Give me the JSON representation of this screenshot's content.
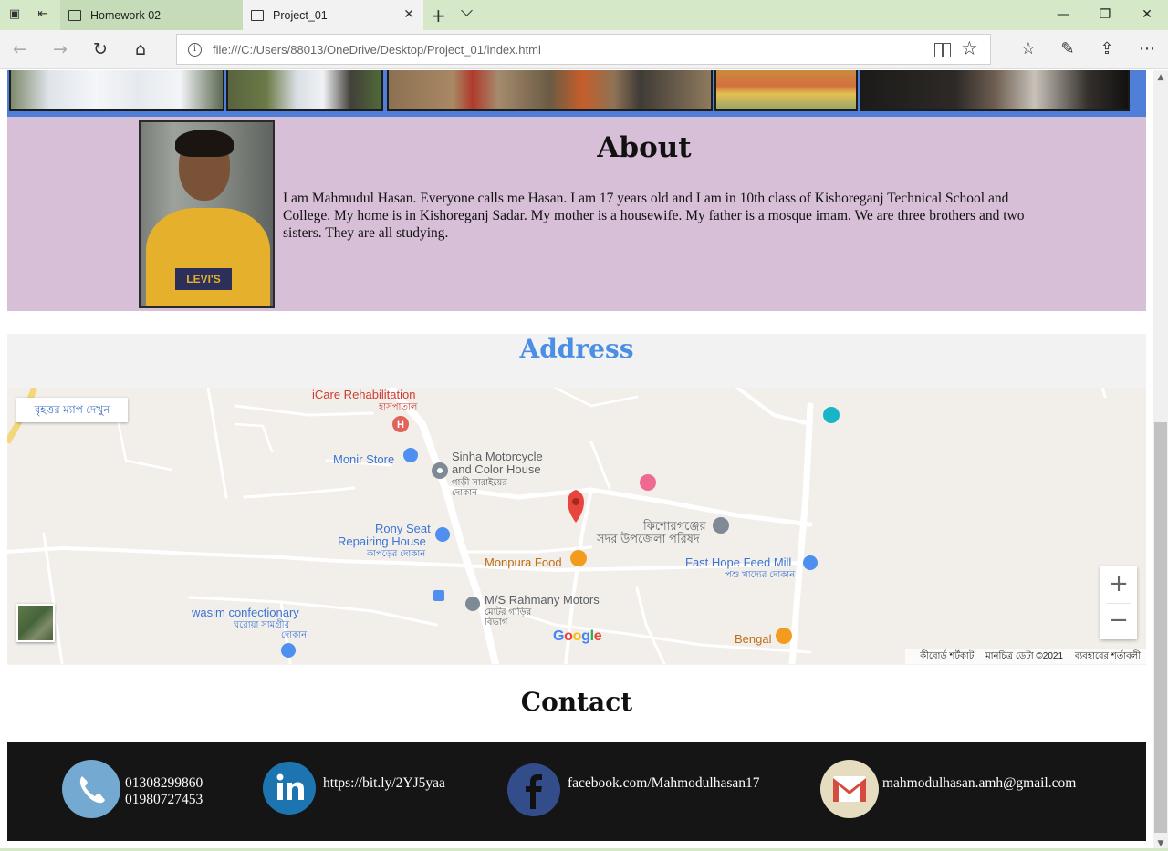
{
  "browser": {
    "tabs": [
      {
        "title": "Homework 02",
        "active": false
      },
      {
        "title": "Project_01",
        "active": true
      }
    ],
    "url": "file:///C:/Users/88013/OneDrive/Desktop/Project_01/index.html",
    "icons": {
      "tab_manager": "tabs-icon",
      "set_aside": "set-aside-icon",
      "back": "back-arrow-icon",
      "forward": "forward-arrow-icon",
      "refresh": "refresh-icon",
      "home": "home-icon",
      "favorites": "favorites-icon",
      "notes": "pen-icon",
      "share": "share-icon",
      "more": "more-icon"
    }
  },
  "about": {
    "title": "About",
    "text": "I am Mahmudul Hasan. Everyone calls me Hasan. I am 17 years old and I am in 10th class of Kishoreganj Technical School and College. My home is in Kishoreganj Sadar. My mother is a housewife. My father is a mosque imam. We are three brothers and two sisters. They are all studying.",
    "photo_shirt_text": "LEVI'S"
  },
  "address": {
    "title": "Address",
    "map": {
      "larger_map": "বৃহত্তর ম্যাপ দেখুন",
      "places": {
        "icare": "iCare Rehabilitation",
        "icare_sub": "হাসপাতাল",
        "monir": "Monir Store",
        "sinha_1": "Sinha Motorcycle",
        "sinha_2": "and Color House",
        "sinha_sub_1": "গাড়ী সারাইয়ের",
        "sinha_sub_2": "দোকান",
        "rony_1": "Rony Seat",
        "rony_2": "Repairing House",
        "rony_sub": "কাপড়ের দোকান",
        "kishoreganj_1": "কিশোরগঞ্জের",
        "kishoreganj_2": "সদর উপজেলা পরিষদ",
        "monpura": "Monpura Food",
        "fasthope": "Fast Hope Feed Mill",
        "fasthope_sub": "পশু খাদ্যের দোকান",
        "wasim": "wasim confectionary",
        "wasim_sub_1": "ঘরোয়া সামগ্রীর",
        "wasim_sub_2": "দোকান",
        "rahmany": "M/S Rahmany Motors",
        "rahmany_sub_1": "মোটর গাড়ির",
        "rahmany_sub_2": "বিভাগ",
        "bengal": "Bengal"
      },
      "google": "Google",
      "attribution": {
        "shortcuts": "কীবোর্ড শর্টকাট",
        "data": "মানচিত্র ডেটা ©2021",
        "terms": "ব্যবহারের শর্তাবলী"
      }
    }
  },
  "contact": {
    "title": "Contact",
    "phone_1": "01308299860",
    "phone_2": "01980727453",
    "linkedin": "https://bit.ly/2YJ5yaa",
    "facebook": "facebook.com/Mahmodulhasan17",
    "email": "mahmodulhasan.amh@gmail.com"
  },
  "colors": {
    "tabbar": "#d5e9c8",
    "gallery_frame": "#4f7fd8",
    "about_bg": "#d8bfd8",
    "address_title": "#4a8ee6",
    "footer_bg": "#151515"
  }
}
